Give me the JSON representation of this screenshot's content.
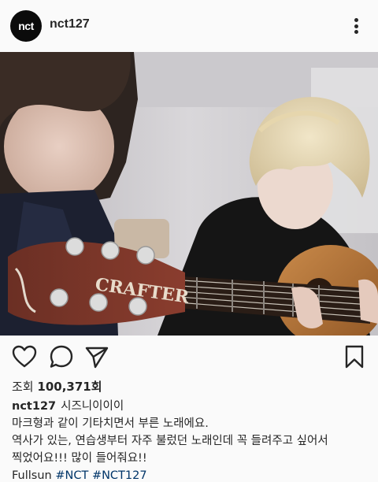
{
  "header": {
    "avatar_text": "nct",
    "username": "nct127"
  },
  "icons": {
    "more": "more-options-icon",
    "like": "heart-icon",
    "comment": "comment-icon",
    "share": "share-icon",
    "save": "bookmark-icon"
  },
  "media": {
    "guitar_brand": "CRAFTER"
  },
  "stats": {
    "views_label": "조회",
    "views_count": "100,371회"
  },
  "caption": {
    "username": "nct127",
    "line1": "시즈니이이이",
    "line2": "마크형과 같이 기타치면서 부른 노래에요.",
    "line3": "역사가 있는, 연습생부터 자주 불렀던 노래인데 꼭 들려주고 싶어서",
    "line4": "찍었어요!!! 많이 들어줘요!!",
    "song": "Fullsun",
    "hashtags": [
      "#NCT",
      "#NCT127"
    ]
  },
  "colors": {
    "background": "#fafafa",
    "text": "#262626",
    "hashtag": "#003569",
    "avatar_bg": "#0b0b0b"
  }
}
